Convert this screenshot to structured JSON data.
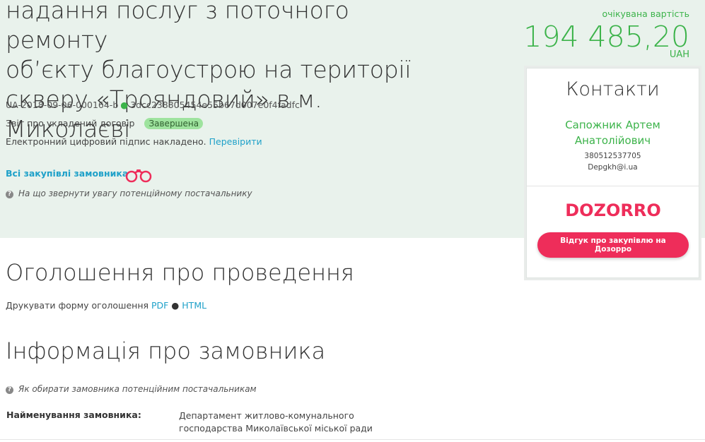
{
  "tender": {
    "title_lines": [
      "надання послуг з поточного ремонту",
      "об’єкту благоустрою на території",
      "скверу «Трояндовий» в м. Миколаєві"
    ],
    "id": "UA-2018-09-06-000164-b",
    "hash": "3dcc238805454e55b67d007e0f4fadfc",
    "contract_report_label": "Звіт про укладений договір",
    "status_badge": "Завершена",
    "signature_text": "Електронний цифровий підпис накладено.",
    "verify_link": "Перевірити",
    "all_purchases_link": "Всі закупівлі замовника",
    "hint_supplier": "На що звернути увагу потенційному постачальнику"
  },
  "expected_value": {
    "label": "очікувана вартість",
    "amount": "194 485,20",
    "currency": "UAH"
  },
  "contacts": {
    "title": "Контакти",
    "name": "Сапожник Артем Анатолійович",
    "phone": "380512537705",
    "email": "Depgkh@i.ua",
    "dozorro_logo": "DOZORRO",
    "dozorro_button": "Відгук про закупівлю на Дозорро"
  },
  "announcement": {
    "title": "Оголошення про проведення",
    "print_label": "Друкувати форму оголошення",
    "pdf_link": "PDF",
    "html_link": "HTML"
  },
  "customer_info": {
    "title": "Інформація про замовника",
    "hint": "Як обирати замовника потенційним постачальникам",
    "name_label": "Найменування замовника:",
    "name_value": "Департамент житлово-комунального господарства Миколаївської міської ради"
  },
  "colors": {
    "accent_green": "#3cb34a",
    "link_blue": "#1fa1c9",
    "dozorro_red": "#ee2d5a",
    "band_bg": "#e9f2ec"
  }
}
